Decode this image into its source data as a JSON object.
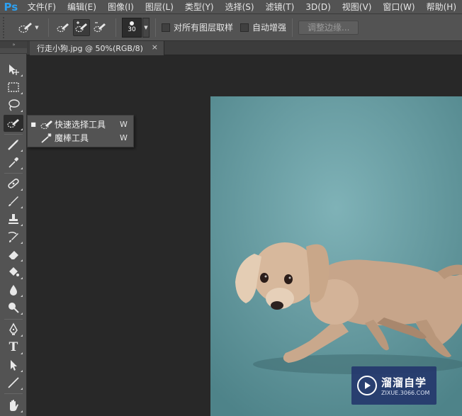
{
  "app": {
    "logo": "Ps"
  },
  "menu": [
    "文件(F)",
    "编辑(E)",
    "图像(I)",
    "图层(L)",
    "类型(Y)",
    "选择(S)",
    "滤镜(T)",
    "3D(D)",
    "视图(V)",
    "窗口(W)",
    "帮助(H)"
  ],
  "options": {
    "brush_size": "30",
    "sample_all_layers": "对所有图层取样",
    "auto_enhance": "自动增强",
    "refine_edge": "调整边缘..."
  },
  "document": {
    "tab_label": "行走小狗.jpg @ 50%(RGB/8)",
    "close_glyph": "×"
  },
  "flyout": {
    "items": [
      {
        "label": "快速选择工具",
        "shortcut": "W",
        "icon": "quick-selection-icon",
        "selected": true
      },
      {
        "label": "魔棒工具",
        "shortcut": "W",
        "icon": "magic-wand-icon",
        "selected": false
      }
    ],
    "bullet": "■"
  },
  "toolbox": {
    "grip": "»",
    "tools": [
      "move-tool",
      "marquee-tool",
      "lasso-tool",
      "quick-selection-tool",
      "crop-tool",
      "eyedropper-tool",
      "healing-brush-tool",
      "brush-tool",
      "clone-stamp-tool",
      "history-brush-tool",
      "eraser-tool",
      "paint-bucket-tool",
      "blur-tool",
      "dodge-tool",
      "pen-tool",
      "type-tool",
      "path-selection-tool",
      "line-tool",
      "hand-tool"
    ]
  },
  "type_tool_glyph": "T",
  "watermark": {
    "title": "溜溜自学",
    "subtitle": "ZIXUE.3066.COM"
  },
  "colors": {
    "canvas_bg": "#282828",
    "panel": "#535353",
    "photo_bg": "#6a9ea3",
    "ps_blue": "#2da0f0"
  }
}
